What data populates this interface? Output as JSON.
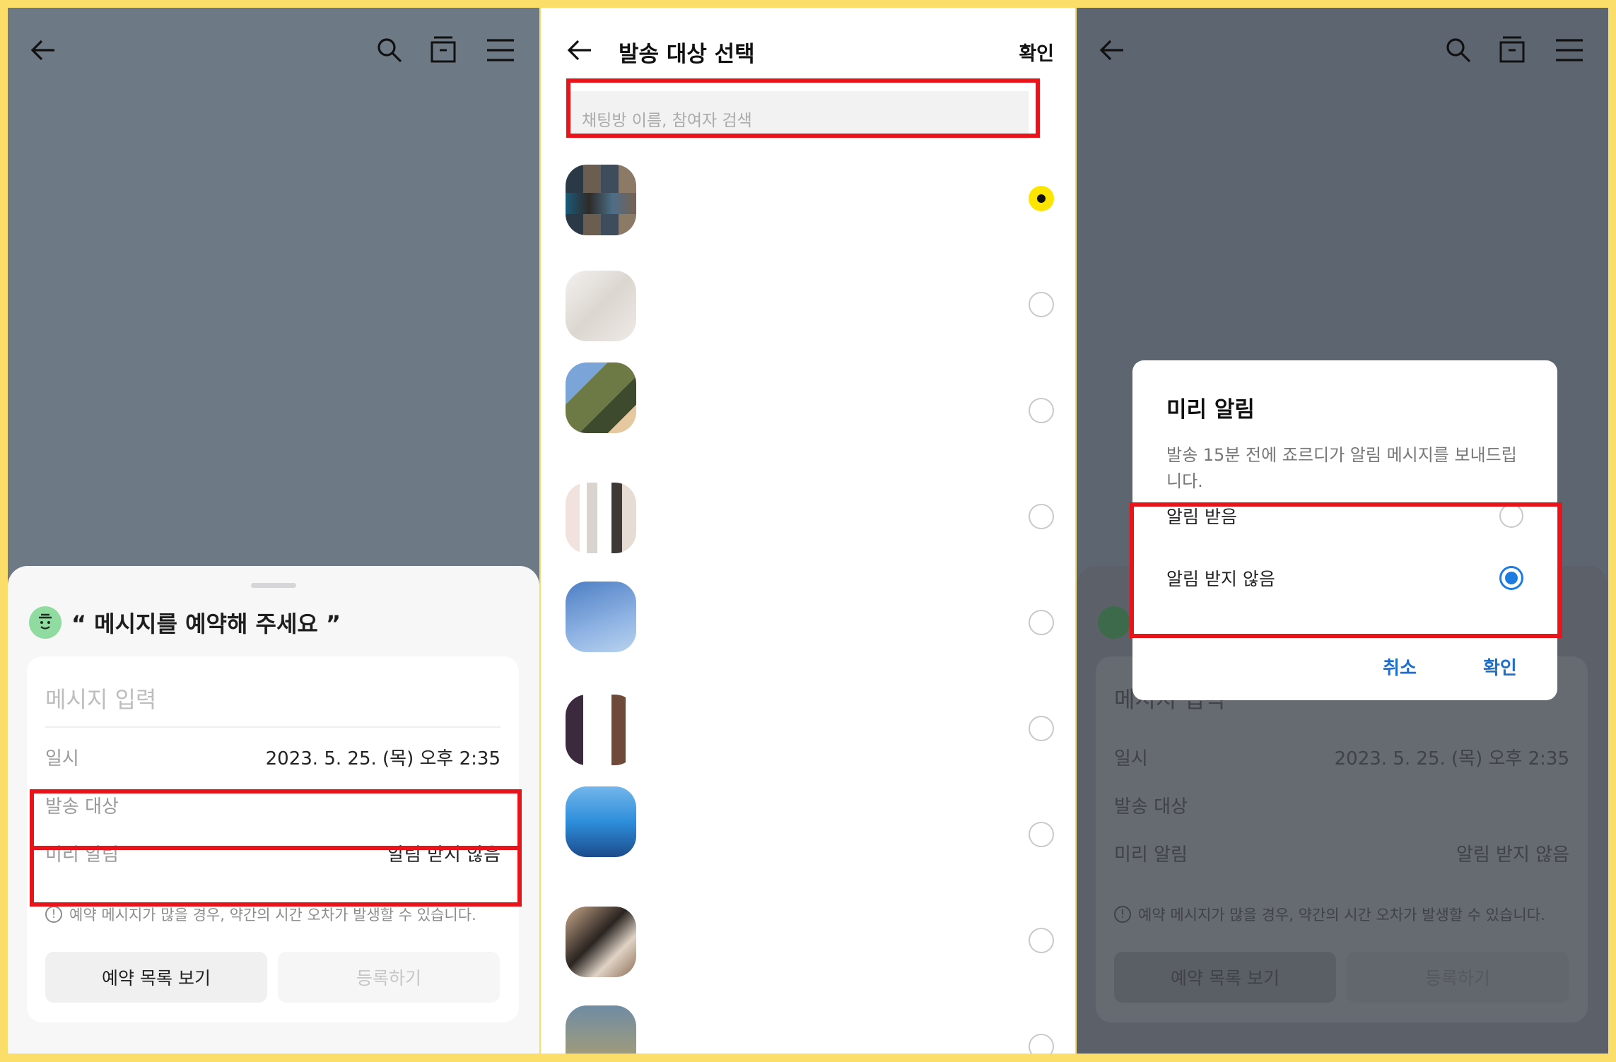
{
  "panel1": {
    "sheet_title": "“ 메시지를 예약해 주세요 ”",
    "message_placeholder": "메시지 입력",
    "rows": [
      {
        "label": "일시",
        "value": "2023. 5. 25. (목) 오후 2:35"
      },
      {
        "label": "발송 대상",
        "value": ""
      },
      {
        "label": "미리 알림",
        "value": "알림 받지 않음"
      }
    ],
    "notice": "예약 메시지가 많을 경우, 약간의 시간 오차가 발생할 수 있습니다.",
    "btn_list": "예약 목록 보기",
    "btn_register": "등록하기"
  },
  "panel2": {
    "title": "발송 대상 선택",
    "confirm": "확인",
    "search_placeholder": "채팅방 이름, 참여자 검색",
    "items": [
      {
        "selected": true
      },
      {
        "selected": false
      },
      {
        "selected": false
      },
      {
        "selected": false
      },
      {
        "selected": false
      },
      {
        "selected": false
      },
      {
        "selected": false
      },
      {
        "selected": false
      },
      {
        "selected": false
      }
    ]
  },
  "panel3": {
    "dialog_title": "미리 알림",
    "dialog_desc": "발송 15분 전에 죠르디가 알림 메시지를 보내드립니다.",
    "option_receive": "알림 받음",
    "option_no_receive": "알림 받지 않음",
    "selected_option": "알림 받지 않음",
    "cancel": "취소",
    "confirm": "확인"
  },
  "colors": {
    "frame": "#FBDD6A",
    "highlight": "#E8141C",
    "kakao_yellow": "#FEE500",
    "radio_blue": "#1D7CE2"
  }
}
